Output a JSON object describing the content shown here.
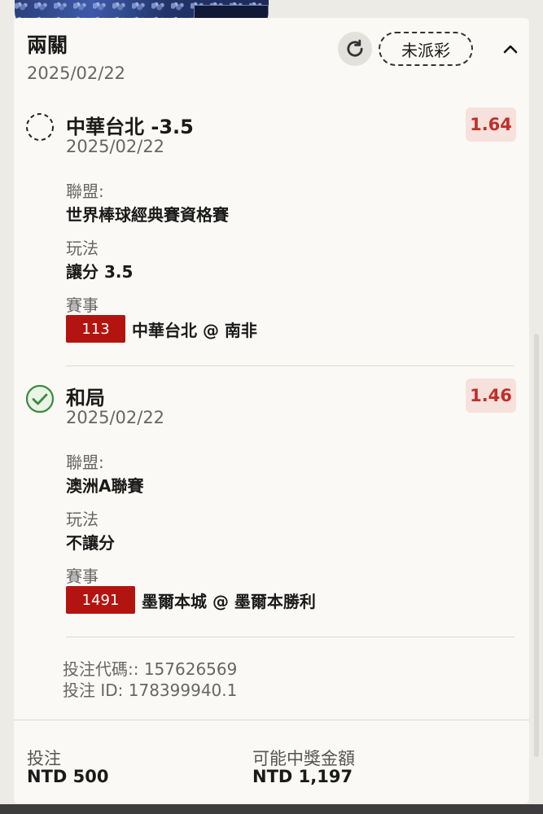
{
  "ticket": {
    "title": "兩關",
    "date": "2025/02/22",
    "status": "未派彩"
  },
  "legs": [
    {
      "status_icon": "pending-dashed-circle",
      "selection": "中華台北 -3.5",
      "date": "2025/02/22",
      "odds": "1.64",
      "league_label": "聯盟:",
      "league": "世界棒球經典賽資格賽",
      "market_label": "玩法",
      "market": "讓分 3.5",
      "event_label": "賽事",
      "event_code": "113",
      "event_name": "中華台北 @ 南非"
    },
    {
      "status_icon": "won-check-circle",
      "selection": "和局",
      "date": "2025/02/22",
      "odds": "1.46",
      "league_label": "聯盟:",
      "league": "澳洲A聯賽",
      "market_label": "玩法",
      "market": "不讓分",
      "event_label": "賽事",
      "event_code": "1491",
      "event_name": "墨爾本城 @ 墨爾本勝利"
    }
  ],
  "bet": {
    "code_text": "投注代碼:: 157626569",
    "id_text": "投注 ID: 178399940.1"
  },
  "footer": {
    "stake_label": "投注",
    "stake_value": "NTD 500",
    "payout_label": "可能中獎金額",
    "payout_value": "NTD 1,197"
  },
  "colors": {
    "odds_text": "#c0302a",
    "odds_bg": "#f6e1dc",
    "event_code_bg": "#b4140f",
    "won_green": "#3b8a3e"
  }
}
